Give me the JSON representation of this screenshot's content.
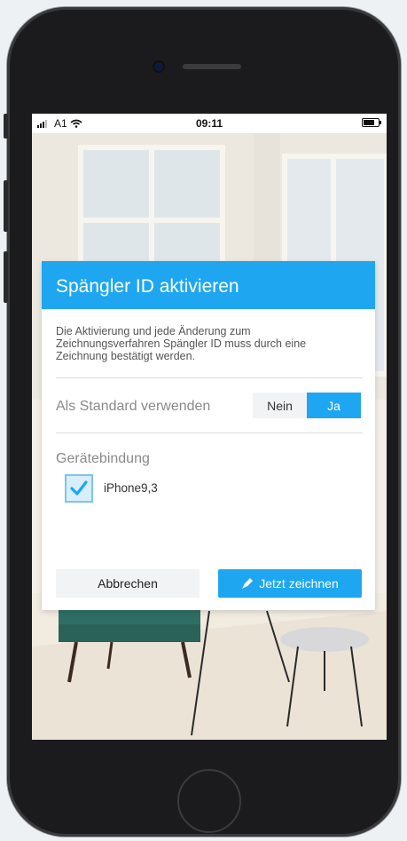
{
  "status_bar": {
    "carrier": "A1",
    "time": "09:11"
  },
  "dialog": {
    "title": "Spängler ID aktivieren",
    "description": "Die Aktivierung und jede Änderung zum Zeichnungsverfahren Spängler ID muss durch eine Zeichnung bestätigt werden.",
    "standard_label": "Als Standard verwenden",
    "toggle": {
      "options": [
        "Nein",
        "Ja"
      ],
      "selected": "Ja"
    },
    "device_binding_label": "Gerätebindung",
    "device": {
      "name": "iPhone9,3",
      "checked": true
    },
    "cancel_label": "Abbrechen",
    "sign_label": "Jetzt zeichnen"
  },
  "colors": {
    "accent": "#1ea7f0"
  },
  "icons": {
    "signal": "signal-bars-icon",
    "wifi": "wifi-icon",
    "battery": "battery-icon",
    "checkbox": "checkmark-icon",
    "sign": "pen-nib-icon"
  }
}
